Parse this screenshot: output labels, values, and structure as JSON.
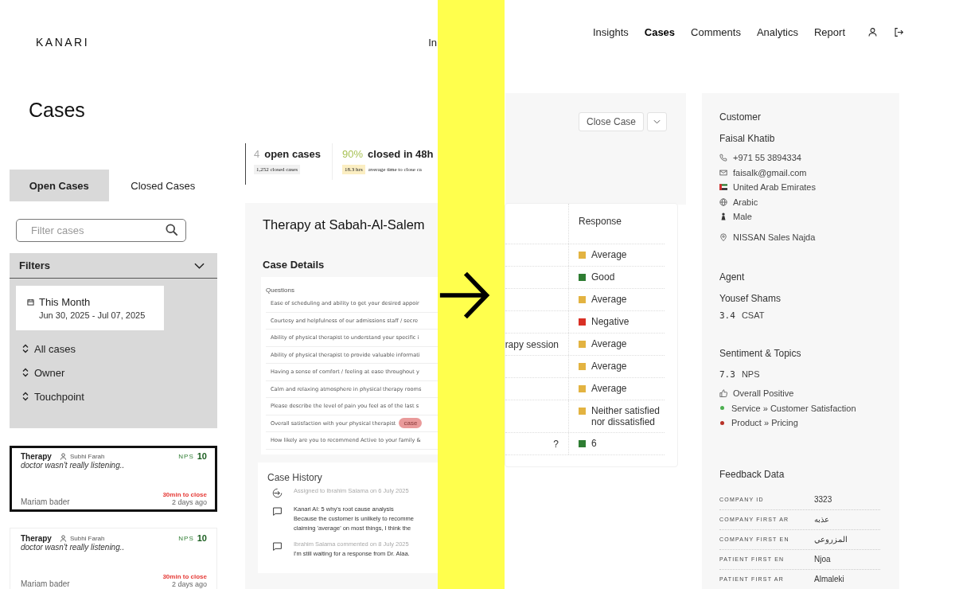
{
  "brand": "KANARI",
  "nav_fragment": "In",
  "nav": [
    {
      "label": "Insights",
      "selected": false
    },
    {
      "label": "Cases",
      "selected": true
    },
    {
      "label": "Comments",
      "selected": false
    },
    {
      "label": "Analytics",
      "selected": false
    },
    {
      "label": "Report",
      "selected": false
    }
  ],
  "page_title": "Cases",
  "tabs": [
    {
      "label": "Open Cases",
      "selected": true
    },
    {
      "label": "Closed Cases",
      "selected": false
    }
  ],
  "search": {
    "placeholder": "Filter cases"
  },
  "filters": {
    "title": "Filters",
    "expanded": true,
    "date_label": "This Month",
    "date_range": "Jun 30, 2025 - Jul 07, 2025",
    "options": [
      "All cases",
      "Owner",
      "Touchpoint"
    ]
  },
  "cases": [
    {
      "category": "Therapy",
      "owner": "Subhi Farah",
      "nps_label": "NPS",
      "nps": "10",
      "comment": "doctor wasn't really listening..",
      "due": "30min to close",
      "customer": "Mariam bader",
      "age": "2 days ago",
      "selected": true
    },
    {
      "category": "Therapy",
      "owner": "Subhi Farah",
      "nps_label": "NPS",
      "nps": "10",
      "comment": "doctor wasn't really listening..",
      "due": "30min to close",
      "customer": "Mariam bader",
      "age": "2 days ago",
      "selected": false
    }
  ],
  "stats": {
    "open_count": "4",
    "open_label": "open cases",
    "closed_note": "1,252 closed cases",
    "rate": "90%",
    "rate_label": "closed in 48h",
    "avg_badge": "18.3 hrs",
    "avg_note": "average time to close ca"
  },
  "actions": {
    "close": "Close Case"
  },
  "case": {
    "title": "Therapy at Sabah-Al-Salem",
    "details_title": "Case Details",
    "questions_header": "Questions",
    "questions": [
      {
        "text": "Ease of scheduling and ability to get your desired appoir"
      },
      {
        "text": "Courtesy and helpfulness of our admissions staff / secre"
      },
      {
        "text": "Ability of physical therapist to understand your specific i"
      },
      {
        "text": "Ability of physical therapist to provide valuable informati"
      },
      {
        "text": "Having a sense of comfort / feeling at ease throughout y"
      },
      {
        "text": "Calm and relaxing atmosphere in physical therapy rooms"
      },
      {
        "text": "Please describe the level of pain you feel as of the last s"
      },
      {
        "text": "Overall satisfaction with your physical therapist",
        "tag": "case"
      },
      {
        "text": "How likely are you to recommend Active to your family &"
      }
    ],
    "response_header": "Response",
    "responses": [
      {
        "text": "Average",
        "color": "#e3b341"
      },
      {
        "text": "Good",
        "color": "#2e7d32"
      },
      {
        "text": "Average",
        "color": "#e3b341"
      },
      {
        "text": "Negative",
        "color": "#d93025"
      },
      {
        "tail": "rapy session",
        "text": "Average",
        "color": "#e3b341"
      },
      {
        "text": "Average",
        "color": "#e3b341"
      },
      {
        "text": "Average",
        "color": "#e3b341"
      },
      {
        "text": "Neither satisfied nor dissatisfied",
        "color": "#e3b341"
      },
      {
        "tail": "?",
        "text": "6",
        "color": "#2e7d32"
      }
    ]
  },
  "history": {
    "title": "Case History",
    "entries": [
      {
        "kind": "assign",
        "meta": "Assigned to Ibrahim Salama on 6 July 2025"
      },
      {
        "kind": "comment",
        "title": "Kanari AI: 5 why's root cause analysis",
        "body": [
          "Because the customer is unlikely to recomme",
          "claiming 'average' on most things, I think the"
        ]
      },
      {
        "kind": "comment",
        "meta": "Ibrahim Salama commented on 8 July 2025",
        "body": [
          "I'm still waiting for a response from Dr. Alaa."
        ]
      }
    ]
  },
  "customer": {
    "title": "Customer",
    "name": "Faisal Khatib",
    "details": [
      {
        "kind": "phone",
        "text": "+971 55 3894334"
      },
      {
        "kind": "email",
        "text": "faisalk@gmail.com"
      },
      {
        "kind": "flag",
        "text": "United Arab Emirates"
      },
      {
        "kind": "language",
        "text": "Arabic"
      },
      {
        "kind": "gender",
        "text": "Male"
      },
      {
        "kind": "location",
        "text": "NISSAN Sales Najda"
      }
    ]
  },
  "agent": {
    "title": "Agent",
    "name": "Yousef Shams",
    "score": "3.4",
    "score_label": "CSAT"
  },
  "sentiment": {
    "title": "Sentiment & Topics",
    "score": "7.3",
    "score_label": "NPS",
    "overall": "Overall Positive",
    "topics": [
      {
        "text": "Service » Customer Satisfaction",
        "color": "#4caf50"
      },
      {
        "text": "Product » Pricing",
        "color": "#b83228"
      }
    ]
  },
  "feedback": {
    "title": "Feedback Data",
    "rows": [
      {
        "label": "COMPANY ID",
        "value": "3323"
      },
      {
        "label": "COMPANY FIRST AR",
        "value": "عذبه"
      },
      {
        "label": "COMPANY FIRST EN",
        "value": "المزروعي"
      },
      {
        "label": "PATIENT FIRST EN",
        "value": "Njoa"
      },
      {
        "label": "PATIENT FIRST AR",
        "value": "Almaleki"
      }
    ]
  }
}
